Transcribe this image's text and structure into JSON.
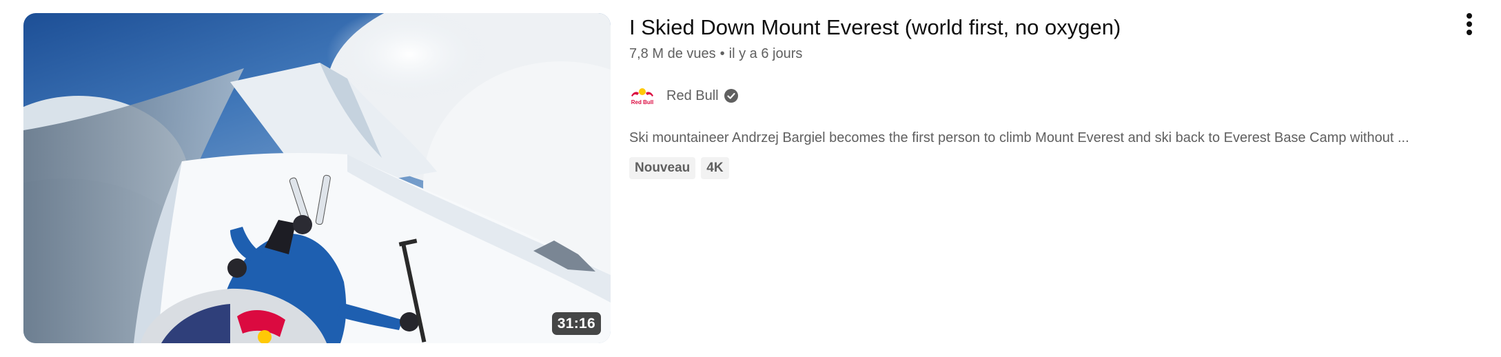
{
  "video": {
    "title": "I Skied Down Mount Everest (world first, no oxygen)",
    "views": "7,8 M de vues",
    "separator": "•",
    "age": "il y a 6 jours",
    "duration": "31:16",
    "description": "Ski mountaineer Andrzej Bargiel becomes the first person to climb Mount Everest and ski back to Everest Base Camp without ...",
    "badges": [
      "Nouveau",
      "4K"
    ],
    "thumbnail_icon": "skier-on-everest-ridge-image"
  },
  "channel": {
    "name": "Red Bull",
    "avatar_icon": "red-bull-logo-icon",
    "avatar_text": "Red Bull",
    "verified_icon": "verified-check-icon"
  },
  "menu": {
    "icon": "more-vertical-icon"
  },
  "colors": {
    "title": "#0f0f0f",
    "secondary_text": "#606060",
    "badge_bg": "#f2f2f2",
    "duration_bg": "#000000",
    "red_bull_red": "#db0a40",
    "red_bull_yellow": "#ffc906",
    "red_bull_blue": "#1a2c6b"
  }
}
